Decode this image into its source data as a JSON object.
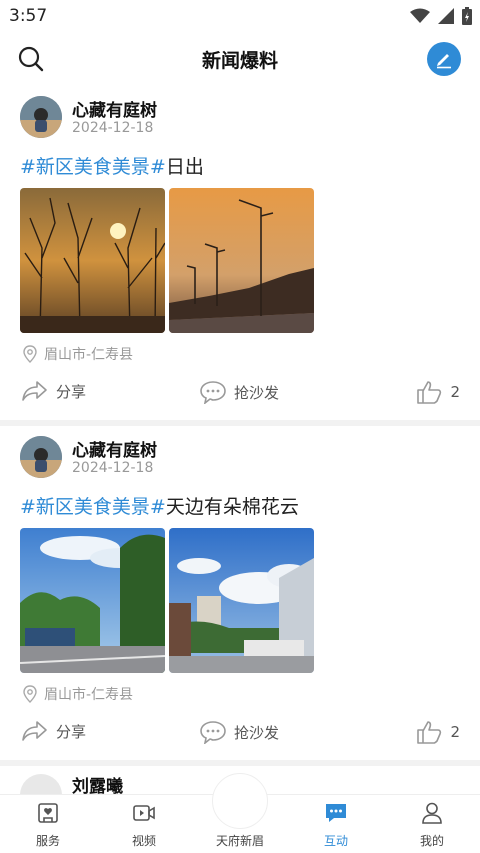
{
  "status": {
    "time": "3:57"
  },
  "header": {
    "title": "新闻爆料"
  },
  "posts": [
    {
      "author": "心藏有庭树",
      "date": "2024-12-18",
      "tag": "#新区美食美景#",
      "text": "日出",
      "location": "眉山市-仁寿县",
      "share": "分享",
      "comment": "抢沙发",
      "likes": "2"
    },
    {
      "author": "心藏有庭树",
      "date": "2024-12-18",
      "tag": "#新区美食美景#",
      "text": "天边有朵棉花云",
      "location": "眉山市-仁寿县",
      "share": "分享",
      "comment": "抢沙发",
      "likes": "2"
    },
    {
      "author": "刘露曦"
    }
  ],
  "tabs": [
    {
      "label": "服务",
      "icon": "service-icon"
    },
    {
      "label": "视频",
      "icon": "video-icon"
    },
    {
      "label": "天府新眉",
      "icon": "home-logo-icon"
    },
    {
      "label": "互动",
      "icon": "chat-icon"
    },
    {
      "label": "我的",
      "icon": "profile-icon"
    }
  ],
  "colors": {
    "accent": "#2f8bd6"
  }
}
